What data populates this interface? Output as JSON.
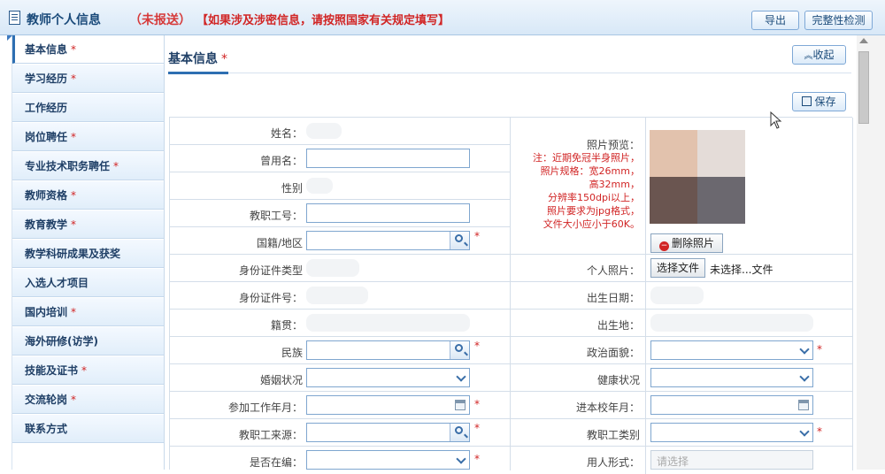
{
  "header": {
    "title": "教师个人信息",
    "status": "（未报送）",
    "notice": "【如果涉及涉密信息，请按照国家有关规定填写】",
    "export_label": "导出",
    "check_label": "完整性检测"
  },
  "sidebar": {
    "items": [
      {
        "label": "基本信息",
        "required": "*"
      },
      {
        "label": "学习经历",
        "required": "*"
      },
      {
        "label": "工作经历",
        "required": ""
      },
      {
        "label": "岗位聘任",
        "required": "*"
      },
      {
        "label": "专业技术职务聘任",
        "required": "*"
      },
      {
        "label": "教师资格",
        "required": "*"
      },
      {
        "label": "教育教学",
        "required": "*"
      },
      {
        "label": "教学科研成果及获奖",
        "required": ""
      },
      {
        "label": "入选人才项目",
        "required": ""
      },
      {
        "label": "国内培训",
        "required": "*"
      },
      {
        "label": "海外研修(访学)",
        "required": ""
      },
      {
        "label": "技能及证书",
        "required": "*"
      },
      {
        "label": "交流轮岗",
        "required": "*"
      },
      {
        "label": "联系方式",
        "required": ""
      }
    ]
  },
  "main": {
    "section_title": "基本信息",
    "section_required": "*",
    "collapse_label": "收起",
    "save_label": "保存"
  },
  "form": {
    "name_label": "姓名：",
    "used_name_label": "曾用名：",
    "gender_label": "性别",
    "staff_no_label": "教职工号：",
    "nationality_label": "国籍/地区",
    "id_type_label": "身份证件类型",
    "id_no_label": "身份证件号：",
    "native_place_label": "籍贯：",
    "ethnicity_label": "民族",
    "marital_label": "婚姻状况",
    "work_start_label": "参加工作年月：",
    "staff_source_label": "教职工来源：",
    "in_staff_label": "是否在编：",
    "photo_preview_label": "照片预览：",
    "photo_note": [
      "注：近期免冠半身照片，",
      "照片规格：宽26mm，",
      "高32mm，",
      "分辨率150dpi以上，",
      "照片要求为jpg格式，",
      "文件大小应小于60K。"
    ],
    "delete_photo_label": "删除照片",
    "personal_photo_label": "个人照片：",
    "choose_file_label": "选择文件",
    "no_file_label": "未选择...文件",
    "birth_date_label": "出生日期：",
    "birth_place_label": "出生地：",
    "political_label": "政治面貌：",
    "health_label": "健康状况",
    "join_school_label": "进本校年月：",
    "staff_category_label": "教职工类别",
    "employment_label": "用人形式：",
    "employment_placeholder": "请选择"
  },
  "colors": {
    "accent": "#2e6fb2",
    "required": "#d12525",
    "sidebar_bg": "#e1eefa"
  }
}
